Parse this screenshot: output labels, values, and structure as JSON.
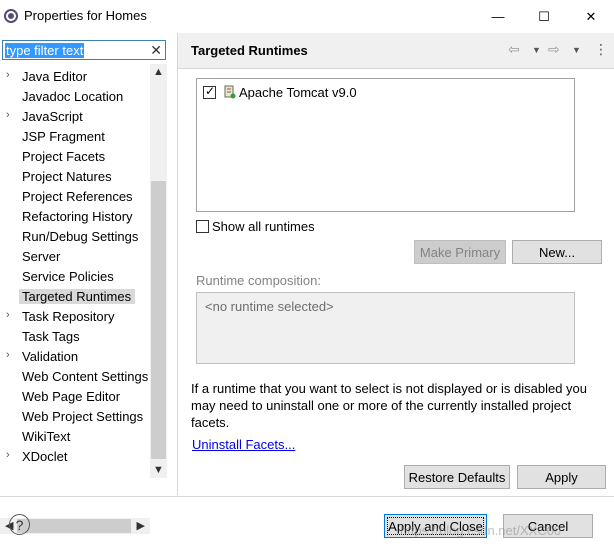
{
  "window": {
    "title": "Properties for Homes",
    "minimize_glyph": "—",
    "maximize_glyph": "☐",
    "close_glyph": "✕"
  },
  "filter": {
    "value": "type filter text",
    "clear_glyph": "✕"
  },
  "tree": {
    "items": [
      {
        "label": "Java Editor",
        "expandable": true
      },
      {
        "label": "Javadoc Location",
        "expandable": false
      },
      {
        "label": "JavaScript",
        "expandable": true
      },
      {
        "label": "JSP Fragment",
        "expandable": false
      },
      {
        "label": "Project Facets",
        "expandable": false
      },
      {
        "label": "Project Natures",
        "expandable": false
      },
      {
        "label": "Project References",
        "expandable": false
      },
      {
        "label": "Refactoring History",
        "expandable": false
      },
      {
        "label": "Run/Debug Settings",
        "expandable": false
      },
      {
        "label": "Server",
        "expandable": false
      },
      {
        "label": "Service Policies",
        "expandable": false
      },
      {
        "label": "Targeted Runtimes",
        "expandable": false,
        "selected": true
      },
      {
        "label": "Task Repository",
        "expandable": true
      },
      {
        "label": "Task Tags",
        "expandable": false
      },
      {
        "label": "Validation",
        "expandable": true
      },
      {
        "label": "Web Content Settings",
        "expandable": false
      },
      {
        "label": "Web Page Editor",
        "expandable": false
      },
      {
        "label": "Web Project Settings",
        "expandable": false
      },
      {
        "label": "WikiText",
        "expandable": false
      },
      {
        "label": "XDoclet",
        "expandable": true
      }
    ],
    "expand_glyph": "›"
  },
  "page": {
    "title": "Targeted Runtimes",
    "nav": {
      "back_glyph": "⇦",
      "forward_glyph": "⇨",
      "dropdown_glyph": "▼",
      "menu_glyph": "⋮"
    }
  },
  "runtimes": [
    {
      "label": "Apache Tomcat v9.0",
      "checked": true
    }
  ],
  "show_all": {
    "label": "Show all runtimes",
    "checked": false
  },
  "buttons": {
    "make_primary": "Make Primary",
    "new": "New...",
    "restore_defaults": "Restore Defaults",
    "apply": "Apply",
    "apply_and_close": "Apply and Close",
    "cancel": "Cancel"
  },
  "composition": {
    "label": "Runtime composition:",
    "placeholder": "<no runtime selected>"
  },
  "info_text": "If a runtime that you want to select is not displayed or is disabled you may need to uninstall one or more of the currently installed project facets.",
  "uninstall_link": "Uninstall Facets...",
  "help_glyph": "?",
  "scroll": {
    "up": "▲",
    "down": "▼",
    "left": "◀",
    "right": "▶"
  },
  "watermark": "https://blog.csdn.net/XXC00"
}
